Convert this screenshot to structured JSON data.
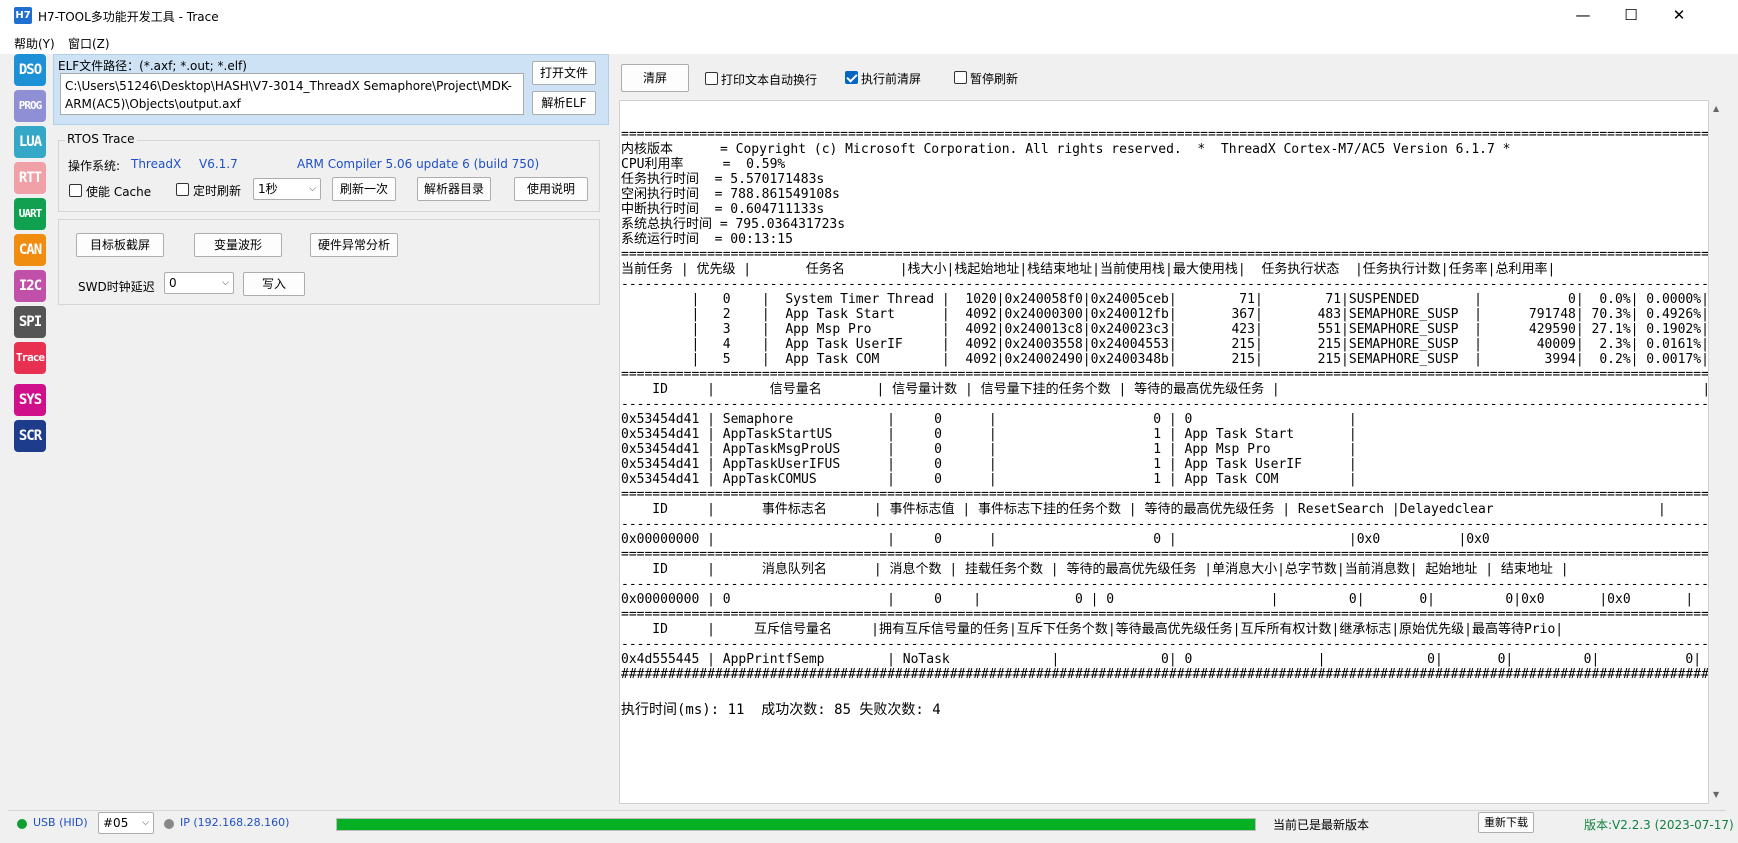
{
  "window": {
    "title": "H7-TOOL多功能开发工具 - Trace",
    "icon_text": "H7",
    "min": "—",
    "max": "☐",
    "close": "✕"
  },
  "menu": [
    "帮助(Y)",
    "窗口(Z)"
  ],
  "sidebar": [
    {
      "label": "DSO",
      "color": "#1e90d6"
    },
    {
      "label": "PROG",
      "color": "#8f8fd6"
    },
    {
      "label": "LUA",
      "color": "#35a8c8"
    },
    {
      "label": "RTT",
      "color": "#f2a0a8"
    },
    {
      "label": "UART",
      "color": "#10a050"
    },
    {
      "label": "CAN",
      "color": "#f08c10"
    },
    {
      "label": "I2C",
      "color": "#c050a8"
    },
    {
      "label": "SPI",
      "color": "#555555"
    },
    {
      "label": "Trace",
      "color": "#e83050"
    },
    {
      "label": "SYS",
      "color": "#d0108a"
    },
    {
      "label": "SCR",
      "color": "#1e3c8c"
    }
  ],
  "elf": {
    "label": "ELF文件路径：(*.axf; *.out; *.elf)",
    "path": "C:\\Users\\51246\\Desktop\\HASH\\V7-3014_ThreadX Semaphore\\Project\\MDK-ARM(AC5)\\Objects\\output.axf",
    "open_button": "打开文件",
    "parse_button": "解析ELF"
  },
  "rtos": {
    "group_title": "RTOS Trace",
    "os_label": "操作系统:",
    "os_name": "ThreadX",
    "os_version": "V6.1.7",
    "compiler": "ARM Compiler 5.06 update 6 (build 750)",
    "cache_label": "使能 Cache",
    "cache_checked": false,
    "timer_label": "定时刷新",
    "timer_checked": false,
    "interval": "1秒",
    "refresh_once": "刷新一次",
    "parser_dir": "解析器目录",
    "usage": "使用说明"
  },
  "tools": {
    "screenshot": "目标板截屏",
    "waveform": "变量波形",
    "fault": "硬件异常分析",
    "swd_label": "SWD时钟延迟",
    "swd_value": "0",
    "write": "写入"
  },
  "terminal_controls": {
    "clear": "清屏",
    "wrap_label": "打印文本自动换行",
    "wrap_checked": false,
    "clear_before_label": "执行前清屏",
    "clear_before_checked": true,
    "pause_label": "暂停刷新",
    "pause_checked": false
  },
  "terminal": {
    "lines": [
      "===============================================================================================================================================",
      "内核版本      = Copyright (c) Microsoft Corporation. All rights reserved.  *  ThreadX Cortex-M7/AC5 Version 6.1.7 *",
      "CPU利用率     =  0.59%",
      "任务执行时间  = 5.570171483s",
      "空闲执行时间  = 788.861549108s",
      "中断执行时间  = 0.604711133s",
      "系统总执行时间 = 795.036431723s",
      "系统运行时间  = 00:13:15",
      "===============================================================================================================================================",
      "当前任务 | 优先级 |       任务名       |栈大小|栈起始地址|栈结束地址|当前使用栈|最大使用栈|  任务执行状态  |任务执行计数|任务率|总利用率|",
      "-----------------------------------------------------------------------------------------------------------------------------------------------",
      "         |   0    |  System Timer Thread |  1020|0x240058f0|0x24005ceb|        71|        71|SUSPENDED       |           0|  0.0%| 0.0000%|",
      "         |   2    |  App Task Start      |  4092|0x24000300|0x240012fb|       367|       483|SEMAPHORE_SUSP  |      791748| 70.3%| 0.4926%|",
      "         |   3    |  App Msp Pro         |  4092|0x240013c8|0x240023c3|       423|       551|SEMAPHORE_SUSP  |      429590| 27.1%| 0.1902%|",
      "         |   4    |  App Task UserIF     |  4092|0x24003558|0x24004553|       215|       215|SEMAPHORE_SUSP  |       40009|  2.3%| 0.0161%|",
      "         |   5    |  App Task COM        |  4092|0x24002490|0x2400348b|       215|       215|SEMAPHORE_SUSP  |        3994|  0.2%| 0.0017%|",
      "===============================================================================================================================================",
      "    ID     |       信号量名       | 信号量计数 | 信号量下挂的任务个数 | 等待的最高优先级任务 |                                                      |",
      "-----------------------------------------------------------------------------------------------------------------------------------------------",
      "0x53454d41 | Semaphore            |     0      |                    0 | 0                    |                                                      |",
      "0x53454d41 | AppTaskStartUS       |     0      |                    1 | App Task Start       |                                                      |",
      "0x53454d41 | AppTaskMsgProUS      |     0      |                    1 | App Msp Pro          |                                                      |",
      "0x53454d41 | AppTaskUserIFUS      |     0      |                    1 | App Task UserIF      |                                                      |",
      "0x53454d41 | AppTaskCOMUS         |     0      |                    1 | App Task COM         |                                                      |",
      "===============================================================================================================================================",
      "    ID     |      事件标志名      | 事件标志值 | 事件标志下挂的任务个数 | 等待的最高优先级任务 | ResetSearch |Delayedclear                     |",
      "-----------------------------------------------------------------------------------------------------------------------------------------------",
      "0x00000000 |                      |     0      |                    0 |                      |0x0          |0x0                              |",
      "===============================================================================================================================================",
      "    ID     |      消息队列名      | 消息个数 | 挂载任务个数 | 等待的最高优先级任务 |单消息大小|总字节数|当前消息数| 起始地址 | 结束地址 |",
      "-----------------------------------------------------------------------------------------------------------------------------------------------",
      "0x00000000 | 0                    |     0    |            0 | 0                    |         0|       0|         0|0x0       |0x0       |",
      "===============================================================================================================================================",
      "    ID     |     互斥信号量名     |拥有互斥信号量的任务|互斥下任务个数|等待最高优先级任务|互斥所有权计数|继承标志|原始优先级|最高等待Prio|",
      "-----------------------------------------------------------------------------------------------------------------------------------------------",
      "0x4d555445 | AppPrintfSemp        | NoTask             |             0| 0                |             0|       0|         0|           0|",
      "###############################################################################################################################################"
    ],
    "footer": "执行时间(ms): 11  成功次数: 85 失败次数: 4"
  },
  "status": {
    "usb": "USB (HID)",
    "port": "#05",
    "ip": "IP (192.168.28.160)",
    "progress_pct": 100,
    "update_text": "当前已是最新版本",
    "redownload": "重新下载",
    "version": "版本:V2.2.3 (2023-07-17)"
  }
}
